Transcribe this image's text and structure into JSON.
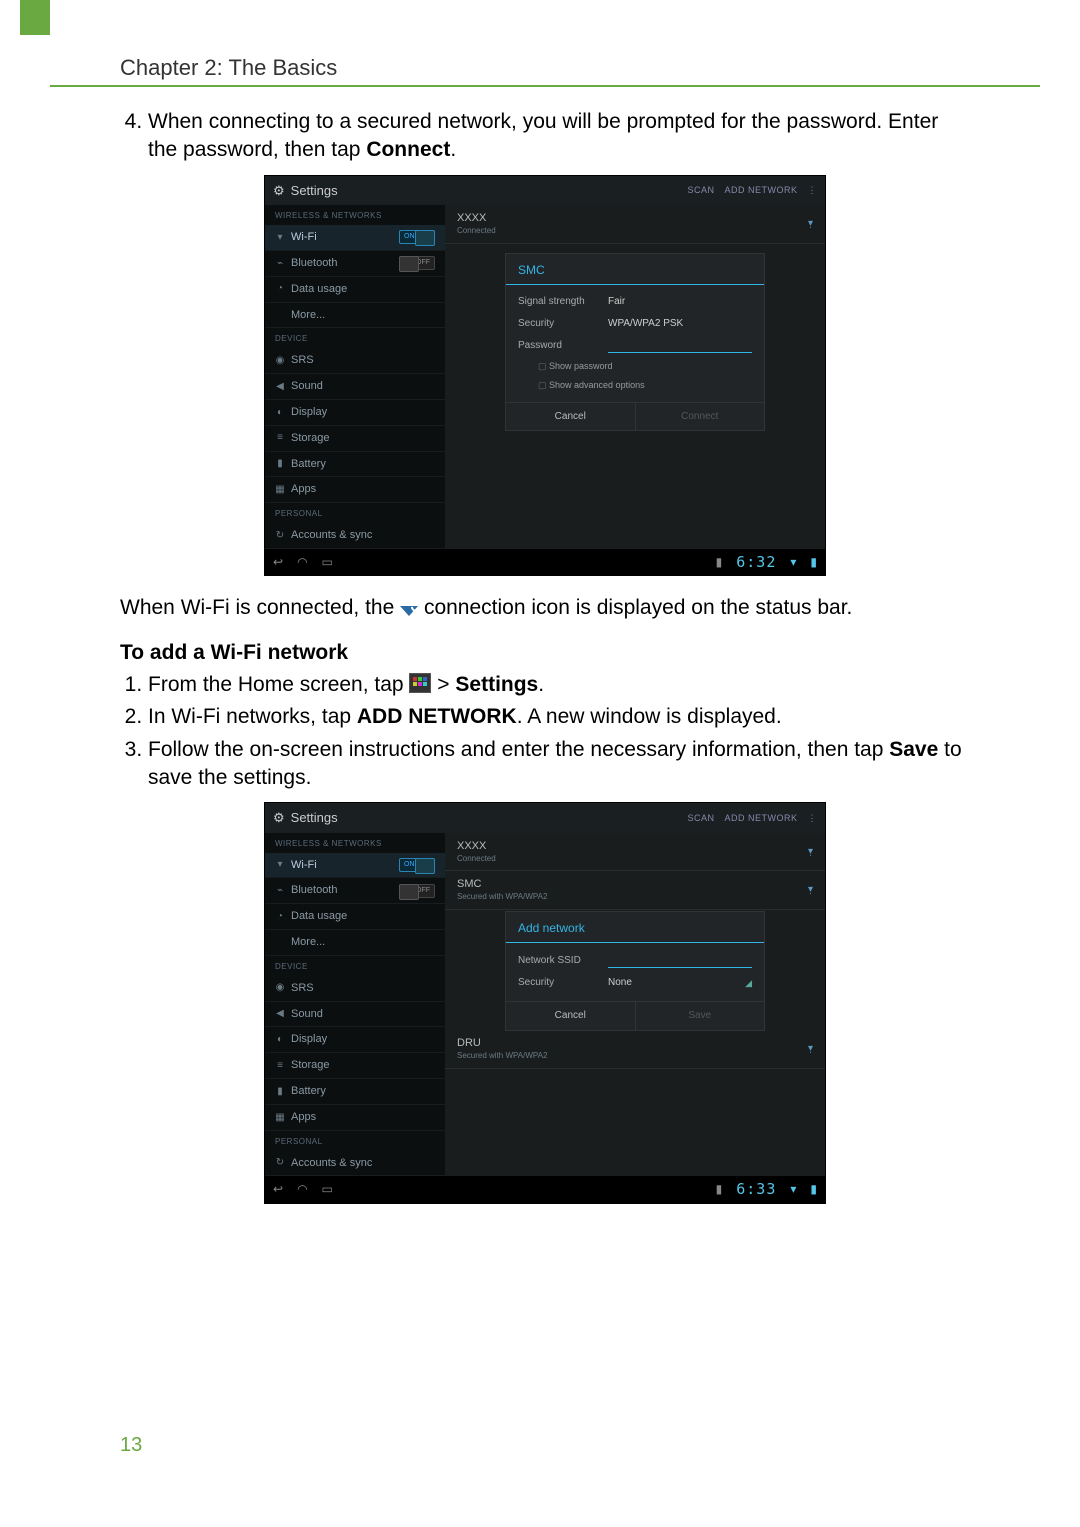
{
  "chapter_title": "Chapter 2: The Basics",
  "page_number": "13",
  "step4_text_a": "When connecting to a secured network, you will be prompted for the password. Enter the password, then tap ",
  "step4_bold": "Connect",
  "after_shot1_a": "When Wi-Fi is connected, the ",
  "after_shot1_b": " connection icon is displayed on the status bar.",
  "add_heading": "To add a Wi-Fi network",
  "add_step1_a": "From the Home screen, tap ",
  "add_step1_b": "  >  ",
  "add_step1_bold": "Settings",
  "add_step2_a": "In Wi-Fi networks, tap ",
  "add_step2_bold": "ADD NETWORK",
  "add_step2_b": ". A new window is displayed.",
  "add_step3_a": "Follow the on-screen instructions and enter the necessary information, then tap ",
  "add_step3_bold": "Save",
  "add_step3_b": " to save the settings.",
  "ss": {
    "title": "Settings",
    "scan": "SCAN",
    "add_network": "ADD NETWORK",
    "sect_wireless": "WIRELESS & NETWORKS",
    "sect_device": "DEVICE",
    "sect_personal": "PERSONAL",
    "nav_wifi": "Wi-Fi",
    "nav_bt": "Bluetooth",
    "nav_data": "Data usage",
    "nav_more": "More...",
    "nav_srs": "SRS",
    "nav_sound": "Sound",
    "nav_display": "Display",
    "nav_storage": "Storage",
    "nav_battery": "Battery",
    "nav_apps": "Apps",
    "nav_accounts": "Accounts & sync",
    "toggle_on": "ON",
    "toggle_off": "OFF",
    "net_xxxx": "XXXX",
    "net_connected": "Connected",
    "net_smc": "SMC",
    "net_smc_sub": "Secured with WPA/WPA2",
    "net_dru": "DRU",
    "net_dru_sub": "Secured with WPA/WPA2"
  },
  "dlg1": {
    "title": "SMC",
    "signal_label": "Signal strength",
    "signal_value": "Fair",
    "security_label": "Security",
    "security_value": "WPA/WPA2 PSK",
    "password_label": "Password",
    "show_password": "Show password",
    "show_advanced": "Show advanced options",
    "cancel": "Cancel",
    "connect": "Connect"
  },
  "dlg2": {
    "title": "Add network",
    "ssid_label": "Network SSID",
    "security_label": "Security",
    "security_value": "None",
    "cancel": "Cancel",
    "save": "Save"
  },
  "sysbar": {
    "time1": "6:32",
    "time2": "6:33"
  }
}
